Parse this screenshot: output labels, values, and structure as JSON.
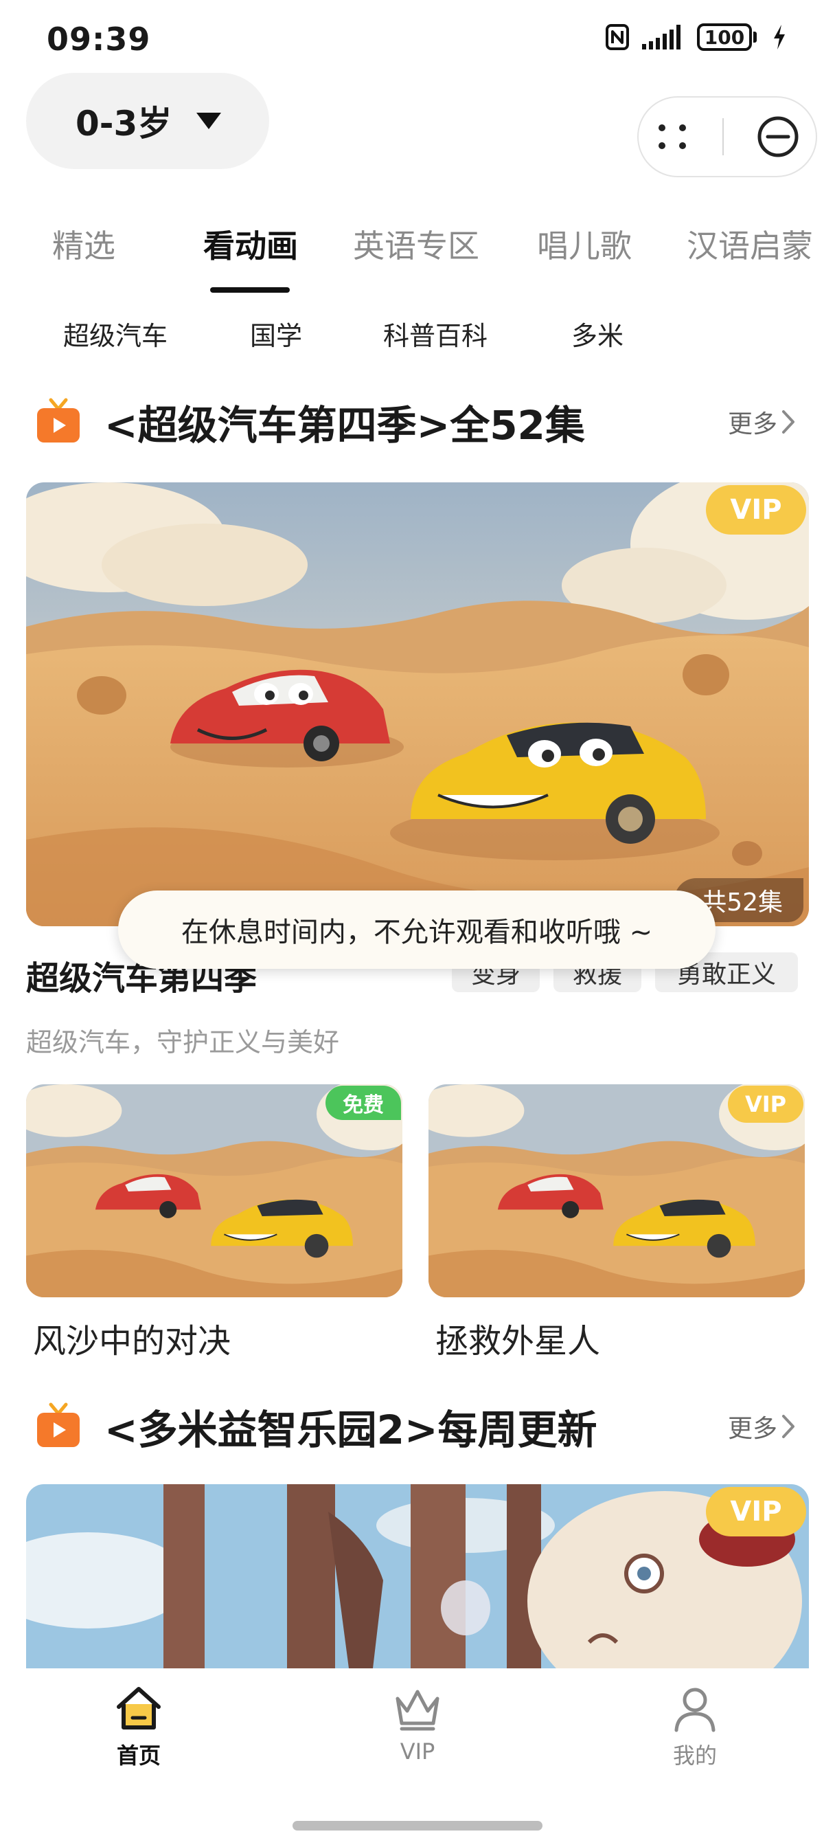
{
  "status": {
    "time": "09:39",
    "battery": "100",
    "icons": [
      "nfc-icon",
      "signal-icon",
      "battery-icon",
      "charging-icon"
    ]
  },
  "age_selector": {
    "label": "0-3岁",
    "icon": "caret-down-icon"
  },
  "capsule": {
    "icons": [
      "more-dots-icon",
      "close-circle-icon"
    ]
  },
  "main_tabs": [
    {
      "label": "精选"
    },
    {
      "label": "看动画"
    },
    {
      "label": "英语专区"
    },
    {
      "label": "唱儿歌"
    },
    {
      "label": "汉语启蒙"
    }
  ],
  "active_tab_index": 1,
  "sub_tabs": [
    {
      "label": "超级汽车"
    },
    {
      "label": "国学"
    },
    {
      "label": "科普百科"
    },
    {
      "label": "多米"
    }
  ],
  "section1": {
    "title": "<超级汽车第四季>全52集",
    "more": "更多",
    "hero_badge": "VIP",
    "episodes_label": "共52集",
    "show_title": "超级汽车第四季",
    "tags": [
      "变身",
      "救援",
      "勇敢正义"
    ],
    "description": "超级汽车，守护正义与美好",
    "cards": [
      {
        "title": "风沙中的对决",
        "badge": "免费"
      },
      {
        "title": "拯救外星人",
        "badge": "VIP"
      }
    ]
  },
  "section2": {
    "title": "<多米益智乐园2>每周更新",
    "more": "更多",
    "hero_badge": "VIP"
  },
  "toast": "在休息时间内，不允许观看和收听哦 ~",
  "bottom_nav": [
    {
      "label": "首页",
      "icon": "home-icon",
      "active": true
    },
    {
      "label": "VIP",
      "icon": "crown-icon",
      "active": false
    },
    {
      "label": "我的",
      "icon": "person-icon",
      "active": false
    }
  ],
  "colors": {
    "accent_orange": "#f5792a",
    "vip_yellow": "#f7c948",
    "free_green": "#4cc55b"
  }
}
